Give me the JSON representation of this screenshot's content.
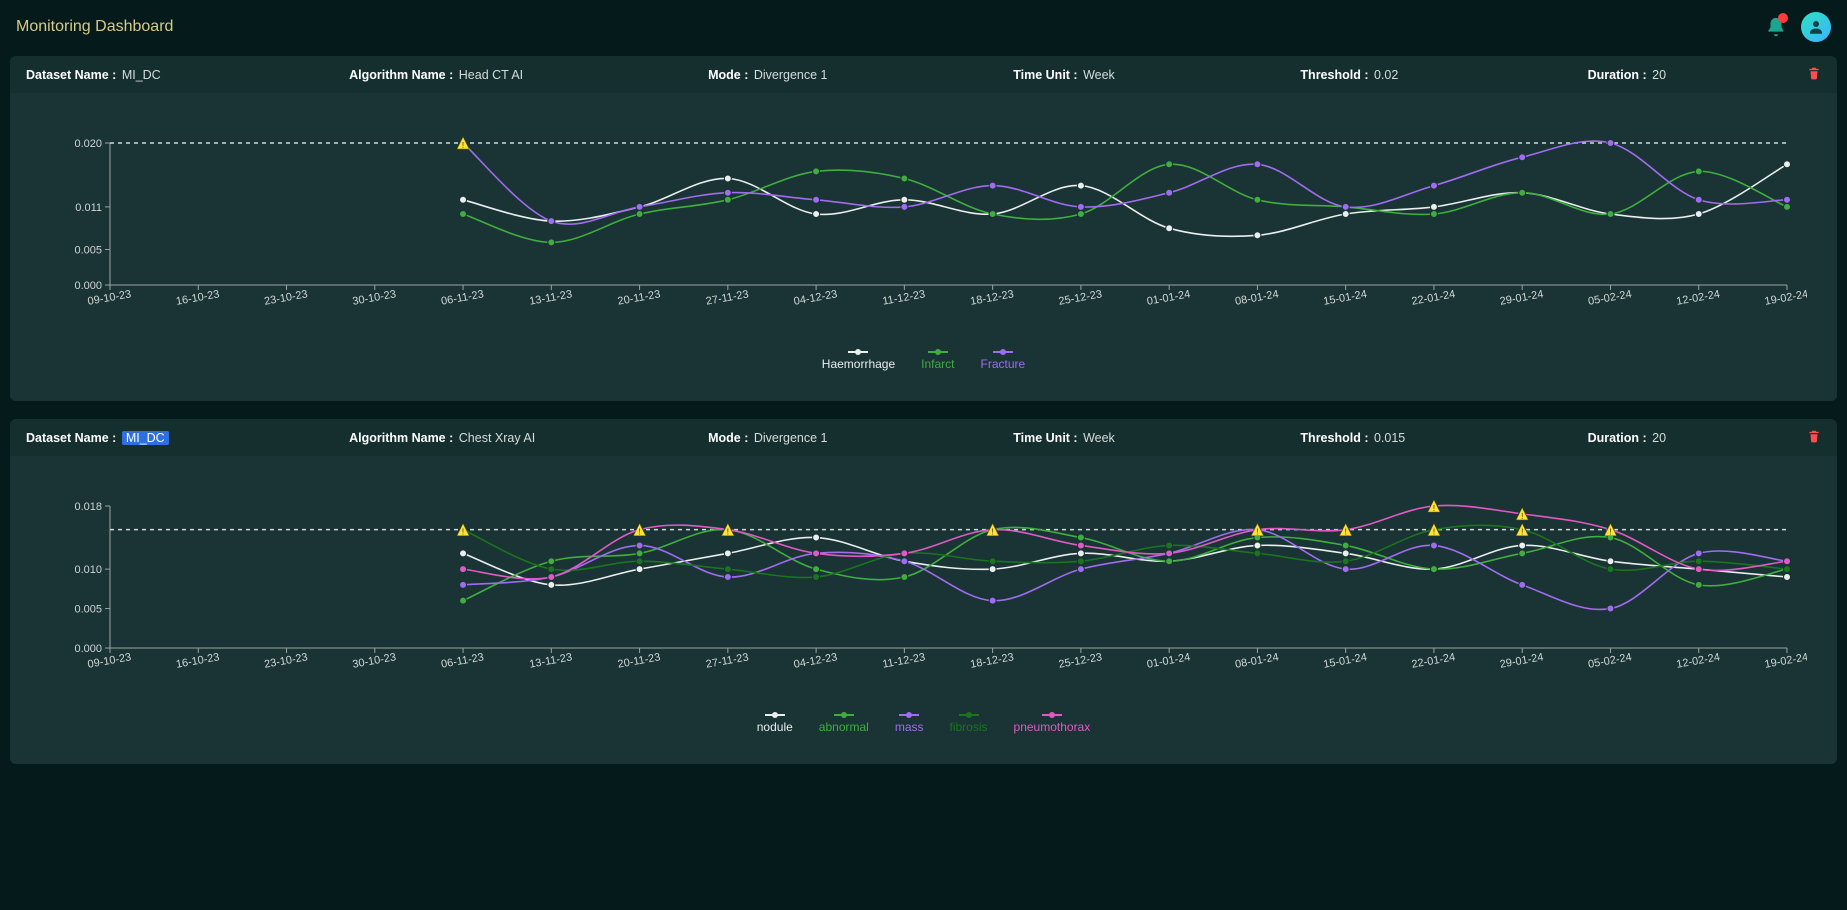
{
  "header": {
    "title": "Monitoring Dashboard"
  },
  "panels": [
    {
      "id": "panel1",
      "meta": {
        "dataset_label": "Dataset Name :",
        "dataset_value": "MI_DC",
        "dataset_selected": false,
        "algo_label": "Algorithm Name :",
        "algo_value": "Head CT AI",
        "mode_label": "Mode :",
        "mode_value": "Divergence 1",
        "timeunit_label": "Time Unit :",
        "timeunit_value": "Week",
        "threshold_label": "Threshold :",
        "threshold_value": "0.02",
        "duration_label": "Duration :",
        "duration_value": "20"
      }
    },
    {
      "id": "panel2",
      "meta": {
        "dataset_label": "Dataset Name :",
        "dataset_value": "MI_DC",
        "dataset_selected": true,
        "algo_label": "Algorithm Name :",
        "algo_value": "Chest Xray AI",
        "mode_label": "Mode :",
        "mode_value": "Divergence 1",
        "timeunit_label": "Time Unit :",
        "timeunit_value": "Week",
        "threshold_label": "Threshold :",
        "threshold_value": "0.015",
        "duration_label": "Duration :",
        "duration_value": "20"
      }
    }
  ],
  "chart_data": [
    {
      "type": "line",
      "title": "",
      "xlabel": "",
      "ylabel": "",
      "ylim": [
        0.0,
        0.02
      ],
      "threshold": 0.02,
      "y_ticks": [
        0.0,
        0.005,
        0.011,
        0.02
      ],
      "y_tick_labels": [
        "0.000",
        "0.005",
        "0.011",
        "0.020"
      ],
      "categories": [
        "09-10-23",
        "16-10-23",
        "23-10-23",
        "30-10-23",
        "06-11-23",
        "13-11-23",
        "20-11-23",
        "27-11-23",
        "04-12-23",
        "11-12-23",
        "18-12-23",
        "25-12-23",
        "01-01-24",
        "08-01-24",
        "15-01-24",
        "22-01-24",
        "29-01-24",
        "05-02-24",
        "12-02-24",
        "19-02-24"
      ],
      "series": [
        {
          "name": "Haemorrhage",
          "color": "#e9eeee",
          "values": [
            null,
            null,
            null,
            null,
            0.012,
            0.009,
            0.011,
            0.015,
            0.01,
            0.012,
            0.01,
            0.014,
            0.008,
            0.007,
            0.01,
            0.011,
            0.013,
            0.01,
            0.01,
            0.017
          ]
        },
        {
          "name": "Infarct",
          "color": "#3fae3f",
          "values": [
            null,
            null,
            null,
            null,
            0.01,
            0.006,
            0.01,
            0.012,
            0.016,
            0.015,
            0.01,
            0.01,
            0.017,
            0.012,
            0.011,
            0.01,
            0.013,
            0.01,
            0.016,
            0.011
          ]
        },
        {
          "name": "Fracture",
          "color": "#a06cf0",
          "values": [
            null,
            null,
            null,
            null,
            0.02,
            0.009,
            0.011,
            0.013,
            0.012,
            0.011,
            0.014,
            0.011,
            0.013,
            0.017,
            0.011,
            0.014,
            0.018,
            0.02,
            0.012,
            0.012
          ]
        }
      ],
      "alerts": [
        {
          "x": "06-11-23",
          "series": "Fracture"
        }
      ]
    },
    {
      "type": "line",
      "title": "",
      "xlabel": "",
      "ylabel": "",
      "ylim": [
        0.0,
        0.018
      ],
      "threshold": 0.015,
      "y_ticks": [
        0.0,
        0.005,
        0.01,
        0.018
      ],
      "y_tick_labels": [
        "0.000",
        "0.005",
        "0.010",
        "0.018"
      ],
      "categories": [
        "09-10-23",
        "16-10-23",
        "23-10-23",
        "30-10-23",
        "06-11-23",
        "13-11-23",
        "20-11-23",
        "27-11-23",
        "04-12-23",
        "11-12-23",
        "18-12-23",
        "25-12-23",
        "01-01-24",
        "08-01-24",
        "15-01-24",
        "22-01-24",
        "29-01-24",
        "05-02-24",
        "12-02-24",
        "19-02-24"
      ],
      "series": [
        {
          "name": "nodule",
          "color": "#e9eeee",
          "values": [
            null,
            null,
            null,
            null,
            0.012,
            0.008,
            0.01,
            0.012,
            0.014,
            0.011,
            0.01,
            0.012,
            0.011,
            0.013,
            0.012,
            0.01,
            0.013,
            0.011,
            0.01,
            0.009
          ]
        },
        {
          "name": "abnormal",
          "color": "#3fae3f",
          "values": [
            null,
            null,
            null,
            null,
            0.006,
            0.011,
            0.012,
            0.015,
            0.01,
            0.009,
            0.015,
            0.014,
            0.011,
            0.014,
            0.013,
            0.01,
            0.012,
            0.014,
            0.008,
            0.01
          ]
        },
        {
          "name": "mass",
          "color": "#a06cf0",
          "values": [
            null,
            null,
            null,
            null,
            0.008,
            0.009,
            0.013,
            0.009,
            0.012,
            0.011,
            0.006,
            0.01,
            0.012,
            0.015,
            0.01,
            0.013,
            0.008,
            0.005,
            0.012,
            0.011
          ]
        },
        {
          "name": "fibrosis",
          "color": "#19751e",
          "values": [
            null,
            null,
            null,
            null,
            0.015,
            0.01,
            0.011,
            0.01,
            0.009,
            0.012,
            0.011,
            0.011,
            0.013,
            0.012,
            0.011,
            0.015,
            0.015,
            0.01,
            0.011,
            0.01
          ]
        },
        {
          "name": "pneumothorax",
          "color": "#e05ac3",
          "values": [
            null,
            null,
            null,
            null,
            0.01,
            0.009,
            0.015,
            0.015,
            0.012,
            0.012,
            0.015,
            0.013,
            0.012,
            0.015,
            0.015,
            0.018,
            0.017,
            0.015,
            0.01,
            0.011
          ]
        }
      ],
      "alerts": [
        {
          "x": "06-11-23",
          "series": "fibrosis"
        },
        {
          "x": "20-11-23",
          "series": "pneumothorax"
        },
        {
          "x": "27-11-23",
          "series": "abnormal"
        },
        {
          "x": "27-11-23",
          "series": "pneumothorax"
        },
        {
          "x": "18-12-23",
          "series": "abnormal"
        },
        {
          "x": "18-12-23",
          "series": "pneumothorax"
        },
        {
          "x": "08-01-24",
          "series": "pneumothorax"
        },
        {
          "x": "08-01-24",
          "series": "mass"
        },
        {
          "x": "15-01-24",
          "series": "pneumothorax"
        },
        {
          "x": "22-01-24",
          "series": "pneumothorax"
        },
        {
          "x": "22-01-24",
          "series": "fibrosis"
        },
        {
          "x": "29-01-24",
          "series": "pneumothorax"
        },
        {
          "x": "29-01-24",
          "series": "fibrosis"
        },
        {
          "x": "05-02-24",
          "series": "pneumothorax"
        }
      ]
    }
  ]
}
